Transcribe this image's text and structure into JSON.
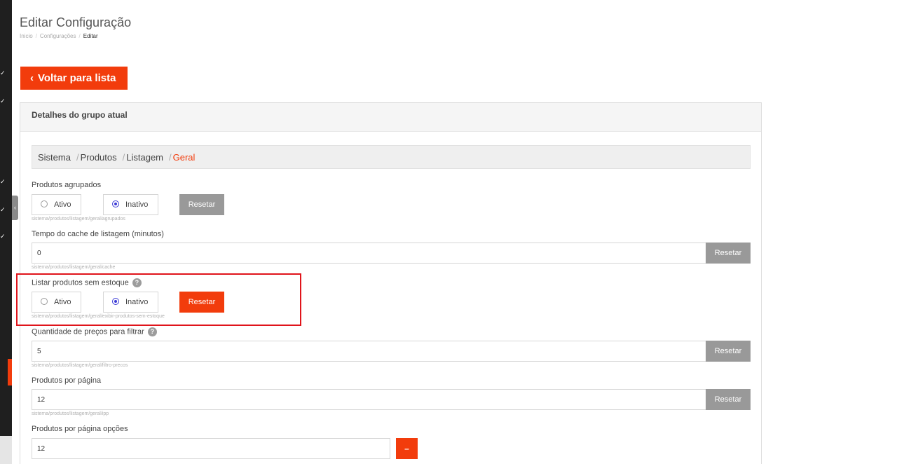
{
  "header": {
    "title": "Editar Configuração",
    "breadcrumb": [
      "Inicio",
      "Configurações",
      "Editar"
    ],
    "back_label": "Voltar para lista"
  },
  "panel": {
    "title": "Detalhes do grupo atual",
    "group_path": [
      "Sistema",
      "Produtos",
      "Listagem",
      "Geral"
    ]
  },
  "fields": {
    "agrupados": {
      "label": "Produtos agrupados",
      "option_on": "Ativo",
      "option_off": "Inativo",
      "selected": "Inativo",
      "reset": "Resetar",
      "path": "sistema/produtos/listagem/geral/agrupados"
    },
    "cache": {
      "label": "Tempo do cache de listagem (minutos)",
      "value": "0",
      "reset": "Resetar",
      "path": "sistema/produtos/listagem/geral/cache"
    },
    "sem_estoque": {
      "label": "Listar produtos sem estoque",
      "option_on": "Ativo",
      "option_off": "Inativo",
      "selected": "Inativo",
      "reset": "Resetar",
      "path": "sistema/produtos/listagem/geral/exibir-produtos-sem-estoque"
    },
    "filtro_precos": {
      "label": "Quantidade de preços para filtrar",
      "value": "5",
      "reset": "Resetar",
      "path": "sistema/produtos/listagem/geral/filtro-precos"
    },
    "ipp": {
      "label": "Produtos por página",
      "value": "12",
      "reset": "Resetar",
      "path": "sistema/produtos/listagem/geral/ipp"
    },
    "ipp_opcoes": {
      "label": "Produtos por página opções",
      "value": "12",
      "remove": "–"
    }
  },
  "icons": {
    "help": "?",
    "back": "‹"
  },
  "colors": {
    "accent": "#f23c0c",
    "reset_grey": "#999999",
    "highlight": "#e0141b",
    "sidebar": "#1f1f1f"
  }
}
